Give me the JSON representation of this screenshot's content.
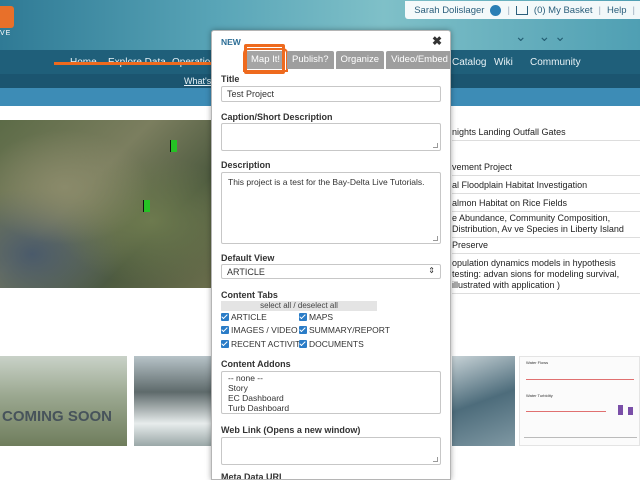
{
  "header": {
    "logo_sub": "VE",
    "user_name": "Sarah Dolislager",
    "basket": "(0) My Basket",
    "help": "Help"
  },
  "nav": {
    "items": [
      "Home",
      "Explore Data",
      "Operations",
      "Catalog",
      "Wiki",
      "Community"
    ],
    "sub_item": "What's"
  },
  "list": {
    "items": [
      "nights Landing Outfall Gates",
      "vement Project",
      "al Floodplain Habitat Investigation",
      "almon Habitat on Rice Fields",
      "e Abundance, Community Composition, Distribution, Av ve Species in Liberty Island",
      " Preserve",
      "opulation dynamics models in hypothesis testing: advan sions for modeling survival, illustrated with application )"
    ]
  },
  "thumbs": {
    "coming_soon": "COMING SOON",
    "dash_title1": "Water Flows",
    "dash_title2": "Water Turbidity"
  },
  "modal": {
    "title": "NEW",
    "close": "✖",
    "tabs": [
      "Map It!",
      "Publish?",
      "Organize",
      "Video/Embed"
    ],
    "title_label": "Title",
    "title_value": "Test Project",
    "caption_label": "Caption/Short Description",
    "caption_value": "",
    "description_label": "Description",
    "description_value": "This project is a test for the Bay-Delta Live Tutorials.",
    "default_view_label": "Default View",
    "default_view_value": "ARTICLE",
    "content_tabs_label": "Content Tabs",
    "select_all": "select all / deselect all",
    "content_tabs": {
      "article": "ARTICLE",
      "maps": "MAPS",
      "images_video": "IMAGES / VIDEO",
      "summary_report": "SUMMARY/REPORT",
      "recent_activity": "RECENT ACTIVITY",
      "documents": "DOCUMENTS"
    },
    "addons_label": "Content Addons",
    "addons_options": [
      "-- none --",
      "Story",
      "EC Dashboard",
      "Turb Dashboard"
    ],
    "web_link_label": "Web Link (Opens a new window)",
    "web_link_value": "",
    "meta_label": "Meta Data URL"
  },
  "colors": {
    "highlight": "#ee6a1e",
    "tab_bg": "#9e9e9e",
    "modal_title": "#2b6d95",
    "checkbox": "#2a7cc7"
  }
}
